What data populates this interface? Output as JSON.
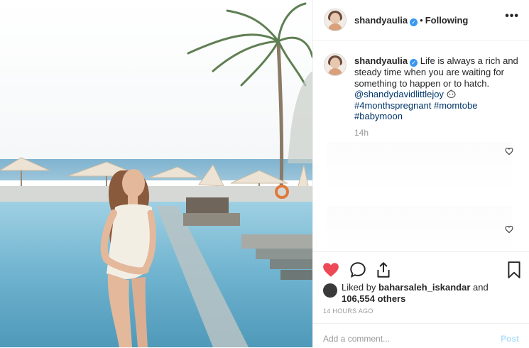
{
  "post": {
    "username": "shandyaulia",
    "separator": "•",
    "follow_status": "Following",
    "more_label": "•••",
    "caption_text": "Life is always a rich and steady time when you are waiting for something to happen or to hatch.",
    "mention": "@shandydavidlittlejoy",
    "hashtags": [
      "#4monthspregnant",
      "#momtobe",
      "#babymoon"
    ],
    "caption_time": "14h",
    "likes_prefix": "Liked by",
    "liked_by_user": "baharsaleh_iskandar",
    "likes_joiner": "and",
    "likes_count": "106,554 others",
    "timestamp": "14 HOURS AGO",
    "comment_placeholder": "Add a comment...",
    "post_button": "Post"
  },
  "icons": {
    "like": "heart-filled-icon",
    "comment": "comment-icon",
    "share": "share-icon",
    "save": "bookmark-icon",
    "verified": "verified-badge-icon"
  },
  "colors": {
    "liked_heart": "#ed4956",
    "link": "#003569",
    "verified": "#3897f0",
    "muted": "#999999",
    "post_disabled": "#b2dffc"
  }
}
